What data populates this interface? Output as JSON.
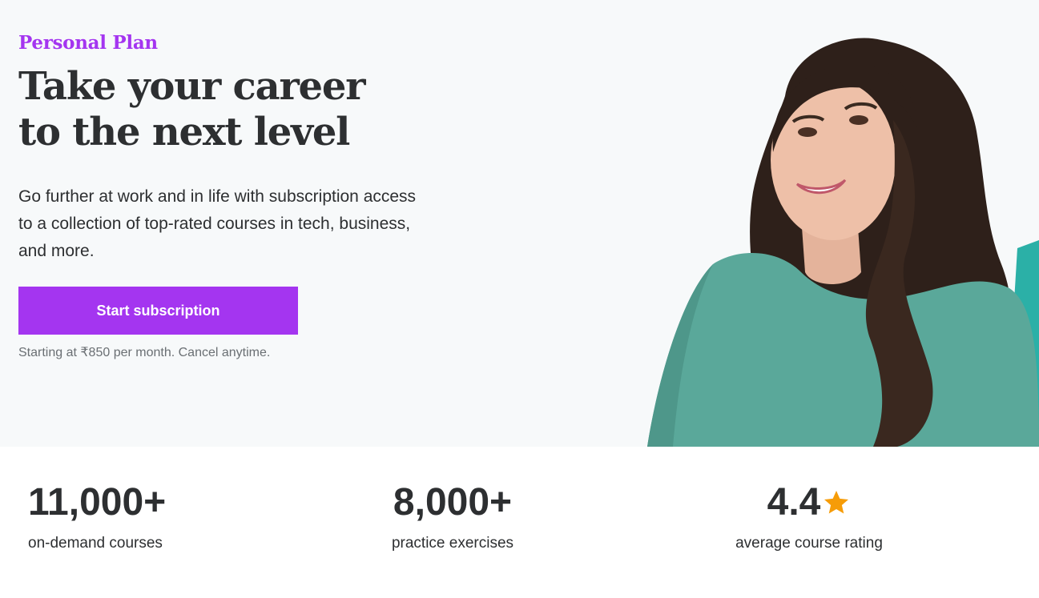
{
  "hero": {
    "eyebrow": "Personal Plan",
    "headline_line1": "Take your career",
    "headline_line2": "to the next level",
    "subtitle": "Go further at work and in life with subscription access to a collection of top-rated courses in tech, business, and more.",
    "cta_label": "Start subscription",
    "pricing_note": "Starting at ₹850 per month. Cancel anytime."
  },
  "stats": [
    {
      "value": "11,000+",
      "label": "on-demand courses"
    },
    {
      "value": "8,000+",
      "label": "practice exercises"
    },
    {
      "value": "4.4",
      "label": "average course rating",
      "icon": "star-icon"
    }
  ],
  "colors": {
    "brand_purple": "#a435f0",
    "text_dark": "#2d2f31",
    "text_muted": "#6a6f73",
    "star": "#f69c08",
    "hero_bg": "#f7f9fa",
    "sweater_teal": "#5aa89a"
  }
}
